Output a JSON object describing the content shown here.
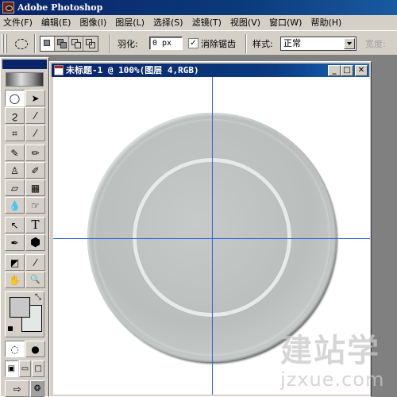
{
  "app": {
    "title": "Adobe Photoshop"
  },
  "menu": [
    {
      "label": "文件(F)"
    },
    {
      "label": "编辑(E)"
    },
    {
      "label": "图像(I)"
    },
    {
      "label": "图层(L)"
    },
    {
      "label": "选择(S)"
    },
    {
      "label": "滤镜(T)"
    },
    {
      "label": "视图(V)"
    },
    {
      "label": "窗口(W)"
    },
    {
      "label": "帮助(H)"
    }
  ],
  "options": {
    "tool_preset": "elliptical-marquee",
    "selection_modes": [
      "new-selection",
      "add-to-selection",
      "subtract-from-selection",
      "intersect-with-selection"
    ],
    "active_mode": "new-selection",
    "feather_label": "羽化:",
    "feather_value": "0 px",
    "antialias_label": "消除锯齿",
    "antialias_checked": true,
    "antialias_mark": "✓",
    "style_label": "样式:",
    "style_value": "正常",
    "width_label": "宽度:"
  },
  "toolbox": {
    "tools": [
      {
        "name": "elliptical-marquee",
        "glyph": "◯",
        "active": true
      },
      {
        "name": "move",
        "glyph": "➤"
      },
      {
        "name": "lasso",
        "glyph": "ϩ"
      },
      {
        "name": "magic-wand",
        "glyph": "⁄"
      },
      {
        "name": "crop",
        "glyph": "⌗"
      },
      {
        "name": "slice",
        "glyph": "⁄"
      },
      {
        "name": "healing-brush",
        "glyph": "✎"
      },
      {
        "name": "brush",
        "glyph": "✏"
      },
      {
        "name": "clone-stamp",
        "glyph": "♙"
      },
      {
        "name": "history-brush",
        "glyph": "✐"
      },
      {
        "name": "eraser",
        "glyph": "▱"
      },
      {
        "name": "gradient",
        "glyph": "▦"
      },
      {
        "name": "blur",
        "glyph": "💧"
      },
      {
        "name": "dodge",
        "glyph": "☞"
      },
      {
        "name": "path-selection",
        "glyph": "↖"
      },
      {
        "name": "type",
        "glyph": "T"
      },
      {
        "name": "pen",
        "glyph": "✒"
      },
      {
        "name": "shape",
        "glyph": "⬢"
      },
      {
        "name": "notes",
        "glyph": "◩"
      },
      {
        "name": "eyedropper",
        "glyph": "⁄"
      },
      {
        "name": "hand",
        "glyph": "✋"
      },
      {
        "name": "zoom",
        "glyph": "🔍"
      }
    ],
    "foreground_color": "#c8c8c8",
    "background_color": "#e4e8e4",
    "swap_glyph": "⤡",
    "mask_modes": [
      {
        "name": "standard-mode",
        "glyph": "◌"
      },
      {
        "name": "quick-mask-mode",
        "glyph": "●"
      }
    ],
    "screen_modes": [
      {
        "name": "standard-screen",
        "glyph": "▣"
      },
      {
        "name": "full-screen-menu",
        "glyph": "▭"
      },
      {
        "name": "full-screen",
        "glyph": "□"
      }
    ],
    "jump_to": [
      {
        "name": "jump-to-imageready",
        "glyph": "⇨"
      },
      {
        "name": "imageready",
        "glyph": "❂"
      }
    ]
  },
  "document": {
    "title": "未标题-1 @ 100%(图层 4,RGB)",
    "buttons": {
      "minimize": "_",
      "maximize": "□",
      "close": "✕"
    }
  },
  "watermark": {
    "cn": "建站学",
    "url": "jzxue.com"
  }
}
